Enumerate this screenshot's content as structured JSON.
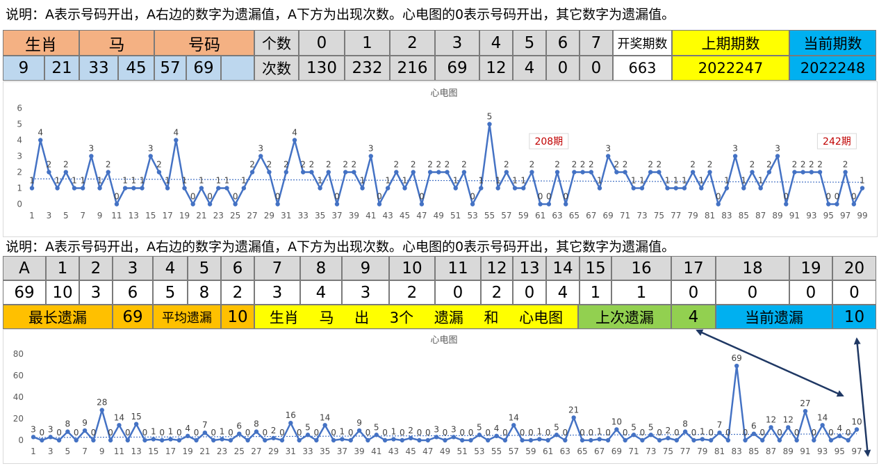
{
  "note_text": "说明：A表示号码开出，A右边的数字为遗漏值，A下方为出现次数。心电图的0表示号码开出，其它数字为遗漏值。",
  "table1": {
    "headers": [
      "生肖",
      "马",
      "号码"
    ],
    "numbers": [
      "9",
      "21",
      "33",
      "45",
      "57",
      "69",
      ""
    ],
    "geshu_label": "个数",
    "cishu_label": "次数",
    "count_keys": [
      "0",
      "1",
      "2",
      "3",
      "4",
      "5",
      "6",
      "7"
    ],
    "count_vals": [
      "130",
      "232",
      "216",
      "69",
      "12",
      "4",
      "0",
      "0"
    ],
    "kaijiang_label": "开奖期数",
    "kaijiang_value": "663",
    "prev_label": "上期期数",
    "prev_value": "2022247",
    "curr_label": "当前期数",
    "curr_value": "2022248"
  },
  "table2": {
    "keys": [
      "A",
      "1",
      "2",
      "3",
      "4",
      "5",
      "6",
      "7",
      "8",
      "9",
      "10",
      "11",
      "12",
      "13",
      "14",
      "15",
      "16",
      "17",
      "18",
      "19",
      "20"
    ],
    "vals": [
      "69",
      "10",
      "3",
      "6",
      "5",
      "8",
      "2",
      "3",
      "4",
      "3",
      "2",
      "0",
      "2",
      "0",
      "4",
      "1",
      "1",
      "0",
      "0",
      "0",
      "0"
    ],
    "max_label": "最长遗漏",
    "max_value": "69",
    "avg_label": "平均遗漏",
    "avg_value": "10",
    "banner_words": [
      "生肖",
      "马",
      "出",
      "3个",
      "遗漏",
      "和",
      "心电图"
    ],
    "last_label": "上次遗漏",
    "last_value": "4",
    "cur_label": "当前遗漏",
    "cur_value": "10"
  },
  "colors": {
    "peach": "#f4b183",
    "lightblue": "#bdd7ee",
    "yellow": "#ffff00",
    "cyan": "#00b0f0",
    "gray": "#d9d9d9",
    "orange": "#ffc000",
    "green": "#92d050",
    "line": "#4472c4",
    "annot": "#c00000",
    "arrow": "#1f3864"
  },
  "chart_data": [
    {
      "type": "line",
      "title": "心电图",
      "ylim": [
        0,
        6
      ],
      "yticks": [
        0,
        1,
        2,
        3,
        4,
        5,
        6
      ],
      "x_labels_every": 2,
      "grid": false,
      "trendline": true,
      "annotations": [
        {
          "text": "208期",
          "x": 62
        },
        {
          "text": "242期",
          "x": 96
        }
      ],
      "x": [
        1,
        2,
        3,
        4,
        5,
        6,
        7,
        8,
        9,
        10,
        11,
        12,
        13,
        14,
        15,
        16,
        17,
        18,
        19,
        20,
        21,
        22,
        23,
        24,
        25,
        26,
        27,
        28,
        29,
        30,
        31,
        32,
        33,
        34,
        35,
        36,
        37,
        38,
        39,
        40,
        41,
        42,
        43,
        44,
        45,
        46,
        47,
        48,
        49,
        50,
        51,
        52,
        53,
        54,
        55,
        56,
        57,
        58,
        59,
        60,
        61,
        62,
        63,
        64,
        65,
        66,
        67,
        68,
        69,
        70,
        71,
        72,
        73,
        74,
        75,
        76,
        77,
        78,
        79,
        80,
        81,
        82,
        83,
        84,
        85,
        86,
        87,
        88,
        89,
        90,
        91,
        92,
        93,
        94,
        95,
        96,
        97,
        98,
        99
      ],
      "values": [
        1,
        4,
        2,
        1,
        2,
        1,
        1,
        3,
        1,
        2,
        0,
        1,
        1,
        1,
        3,
        2,
        1,
        4,
        1,
        0,
        1,
        0,
        1,
        1,
        0,
        1,
        2,
        3,
        2,
        0,
        2,
        4,
        2,
        2,
        1,
        2,
        0,
        2,
        2,
        1,
        3,
        0,
        1,
        2,
        1,
        2,
        0,
        2,
        2,
        2,
        1,
        2,
        0,
        1,
        5,
        1,
        2,
        1,
        1,
        2,
        0,
        0,
        2,
        0,
        2,
        2,
        2,
        1,
        3,
        2,
        2,
        1,
        1,
        2,
        2,
        1,
        1,
        1,
        2,
        1,
        2,
        0,
        1,
        3,
        1,
        2,
        1,
        2,
        3,
        0,
        2,
        2,
        2,
        2,
        0,
        0,
        2,
        0,
        1
      ]
    },
    {
      "type": "line",
      "title": "心电图",
      "ylim": [
        0,
        80
      ],
      "yticks": [
        0,
        20,
        40,
        60,
        80
      ],
      "x_labels_every": 2,
      "grid": false,
      "trendline": true,
      "x": [
        1,
        2,
        3,
        4,
        5,
        6,
        7,
        8,
        9,
        10,
        11,
        12,
        13,
        14,
        15,
        16,
        17,
        18,
        19,
        20,
        21,
        22,
        23,
        24,
        25,
        26,
        27,
        28,
        29,
        30,
        31,
        32,
        33,
        34,
        35,
        36,
        37,
        38,
        39,
        40,
        41,
        42,
        43,
        44,
        45,
        46,
        47,
        48,
        49,
        50,
        51,
        52,
        53,
        54,
        55,
        56,
        57,
        58,
        59,
        60,
        61,
        62,
        63,
        64,
        65,
        66,
        67,
        68,
        69,
        70,
        71,
        72,
        73,
        74,
        75,
        76,
        77,
        78,
        79,
        80,
        81,
        82,
        83,
        84,
        85,
        86,
        87,
        88,
        89,
        90,
        91,
        92,
        93,
        94,
        95,
        96,
        97
      ],
      "values": [
        3,
        0,
        3,
        0,
        8,
        0,
        9,
        0,
        28,
        0,
        14,
        0,
        15,
        0,
        1,
        0,
        1,
        0,
        4,
        0,
        7,
        0,
        1,
        0,
        6,
        0,
        8,
        0,
        2,
        0,
        16,
        0,
        5,
        0,
        14,
        0,
        1,
        0,
        9,
        0,
        5,
        0,
        1,
        0,
        2,
        0,
        0,
        3,
        0,
        3,
        0,
        0,
        5,
        0,
        4,
        0,
        14,
        0,
        0,
        1,
        0,
        5,
        0,
        21,
        0,
        0,
        1,
        0,
        10,
        0,
        5,
        0,
        5,
        0,
        2,
        0,
        8,
        0,
        1,
        0,
        7,
        0,
        69,
        0,
        6,
        0,
        12,
        0,
        12,
        0,
        27,
        0,
        14,
        0,
        4,
        0,
        10
      ]
    }
  ]
}
